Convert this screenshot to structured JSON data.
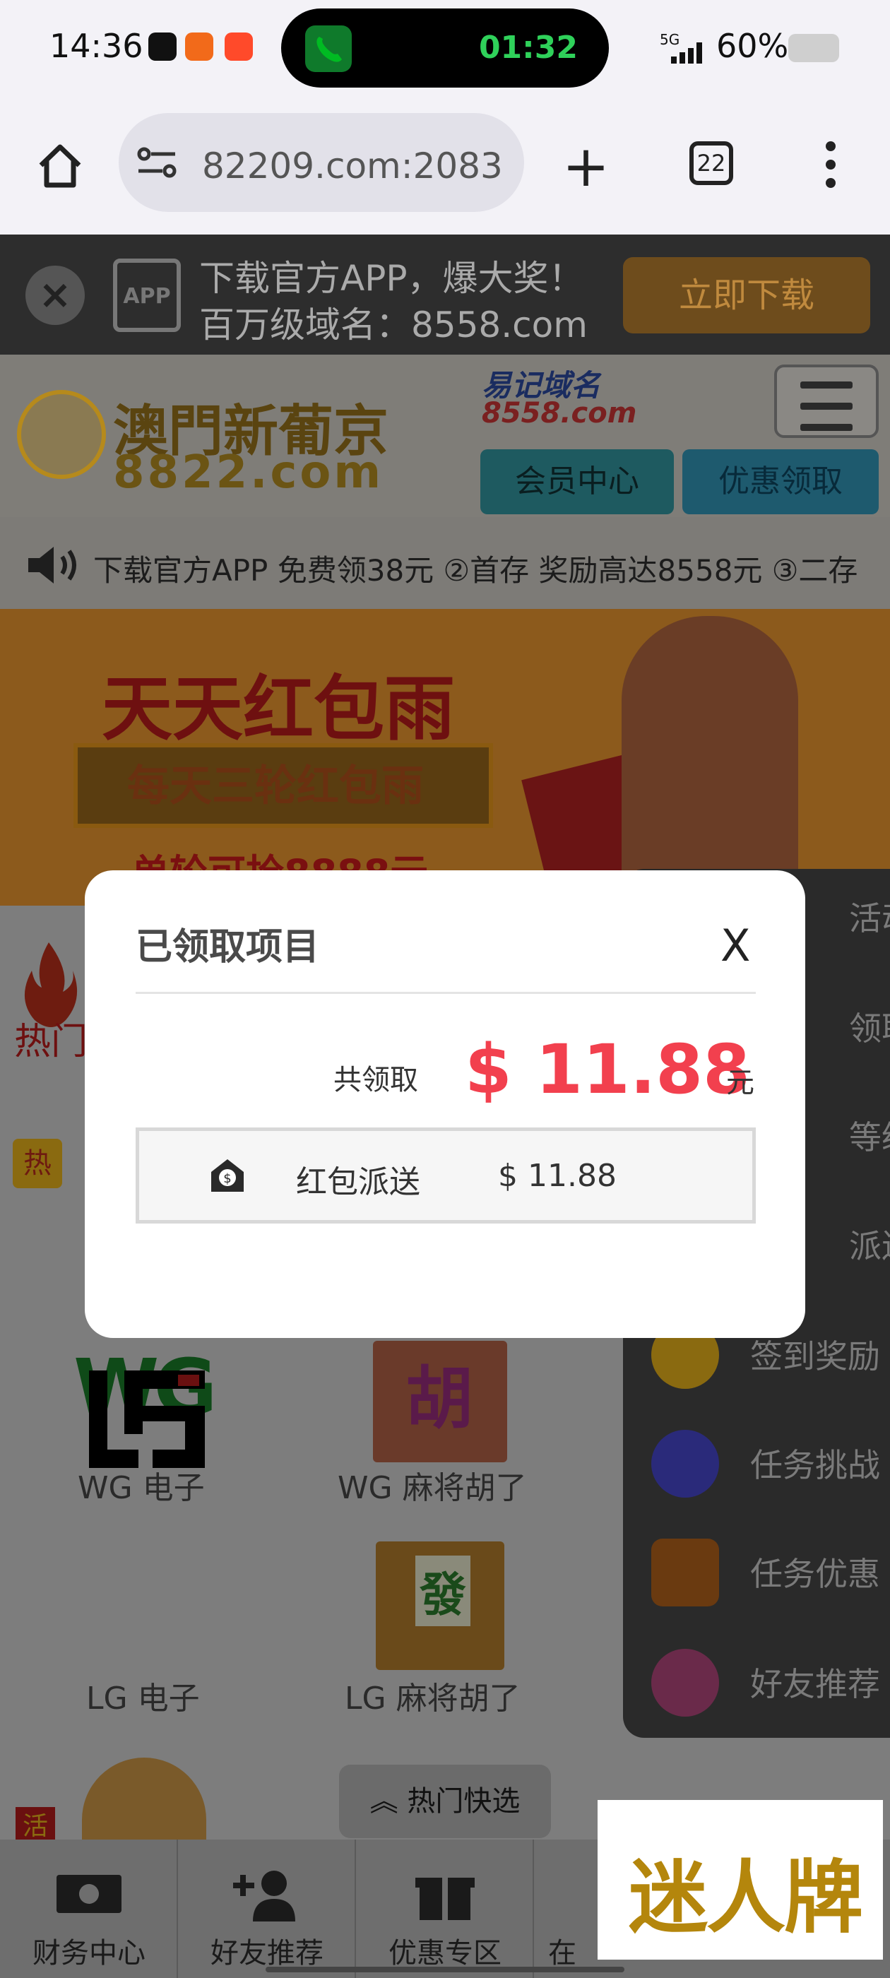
{
  "status_bar": {
    "time": "14:36",
    "call_timer": "01:32",
    "network": "5G",
    "battery_text": "60%",
    "battery_level": 0.6
  },
  "browser": {
    "url": "82209.com:2083",
    "tab_count": "22"
  },
  "download_bar": {
    "app_label": "APP",
    "line1": "下载官方APP，爆大奖！",
    "line2": "百万级域名：8558.com",
    "button": "立即下载"
  },
  "header": {
    "logo_line1": "澳門新葡京",
    "logo_line2": "8822.com",
    "easy_domain_line1": "易记域名",
    "easy_domain_line2": "8558.com",
    "member_button": "会员中心",
    "promo_button": "优惠领取"
  },
  "marquee": {
    "text": "下载官方APP 免费领38元   ②首存 奖励高达8558元   ③二存"
  },
  "banner": {
    "title": "天天红包雨",
    "subtitle": "每天三轮红包雨",
    "caption": "单轮可抢8888元"
  },
  "sections": {
    "hot_label": "热门",
    "hot_badge": "热",
    "live_badge": "活"
  },
  "games": [
    {
      "label": "WG 电子",
      "logo": "WG"
    },
    {
      "label": "WG 麻将胡了",
      "logo": "胡"
    },
    {
      "label": "LG 电子",
      "logo": "LG"
    },
    {
      "label": "LG 麻将胡了",
      "logo": "發"
    }
  ],
  "side_menu": {
    "items": [
      {
        "label": "活动",
        "icon": "gift-icon",
        "color": "#6a4a10"
      },
      {
        "label": "领取",
        "icon": "redpack-icon",
        "color": "#6a1414"
      },
      {
        "label": "等级",
        "icon": "level-icon",
        "color": "#3a3a3a"
      },
      {
        "label": "派送",
        "icon": "delivery-icon",
        "color": "#3a3a3a"
      },
      {
        "label": "签到奖励",
        "icon": "checkin-icon",
        "color": "#8a6a10"
      },
      {
        "label": "任务挑战",
        "icon": "grid-icon",
        "color": "#2a2a7a"
      },
      {
        "label": "任务优惠",
        "icon": "task-promo-icon",
        "color": "#6a3a10"
      },
      {
        "label": "好友推荐",
        "icon": "friends-icon",
        "color": "#6a2a4a"
      }
    ]
  },
  "quick_nav": {
    "label": "热门快选"
  },
  "bottom_nav": {
    "items": [
      {
        "label": "财务中心",
        "icon": "cash-icon"
      },
      {
        "label": "好友推荐",
        "icon": "add-friend-icon"
      },
      {
        "label": "优惠专区",
        "icon": "gift-icon"
      },
      {
        "label": "在",
        "icon": "service-icon"
      }
    ]
  },
  "watermark": "迷人牌",
  "modal": {
    "title": "已领取项目",
    "close": "X",
    "total_label": "共领取",
    "total_amount": "$ 11.88",
    "unit": "元",
    "row_label": "红包派送",
    "row_amount": "$ 11.88",
    "accent_color": "#f2404e"
  }
}
